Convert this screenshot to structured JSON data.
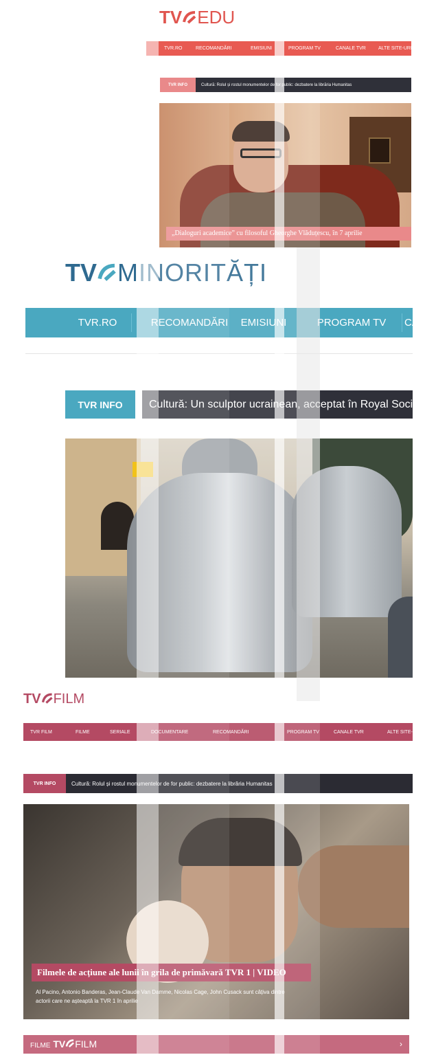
{
  "edu": {
    "logo_prefix": "TV",
    "logo_suffix": "EDU",
    "nav": [
      "TVR.RO",
      "RECOMANDĂRI",
      "EMISIUNI",
      "PROGRAM TV",
      "CANALE TVR",
      "ALTE SITE-URI"
    ],
    "ticker_label": "TVR INFO",
    "ticker_text": "Cultură: Rolul și rostul monumentelor de for public: dezbatere la librăria Humanitas",
    "caption": "„Dialoguri academice” cu filosoful Gheorghe Vlăduțescu, în 7 aprilie"
  },
  "minoritati": {
    "logo_prefix": "TV",
    "logo_suffix": "MINORITĂȚI",
    "nav": [
      "TVR.RO",
      "RECOMANDĂRI",
      "EMISIUNI",
      "PROGRAM TV",
      "CANALE TVR"
    ],
    "ticker_label": "TVR INFO",
    "ticker_text": "Cultură: Un sculptor ucrainean, acceptat în Royal Society"
  },
  "film": {
    "logo_prefix": "TV",
    "logo_suffix": "FILM",
    "nav": [
      "TVR FILM",
      "FILME",
      "SERIALE",
      "DOCUMENTARE",
      "RECOMANDĂRI",
      "PROGRAM TV",
      "CANALE TVR",
      "ALTE SITE-URI"
    ],
    "ticker_label": "TVR INFO",
    "ticker_text": "Cultură: Rolul și rostul monumentelor de for public: dezbatere la librăria Humanitas",
    "caption_title": "Filmele de acțiune ale lunii în grila de primăvară TVR 1 | VIDEO",
    "caption_sub_1": "Al Pacino, Antonio Banderas, Jean-Claude Van Damme, Nicolas Cage, John Cusack sunt câțiva dintre",
    "caption_sub_2": "actorii care ne așteaptă la TVR 1 în aprilie",
    "footer_label": "FILME",
    "footer_logo_suffix": "FILM",
    "footer_arrow": "›"
  },
  "colors": {
    "tvr_red": "#e0554f",
    "edu_red": "#e85a52",
    "teal": "#4aa8c0",
    "film_rose": "#b44a63",
    "dark": "#2b2b33"
  }
}
